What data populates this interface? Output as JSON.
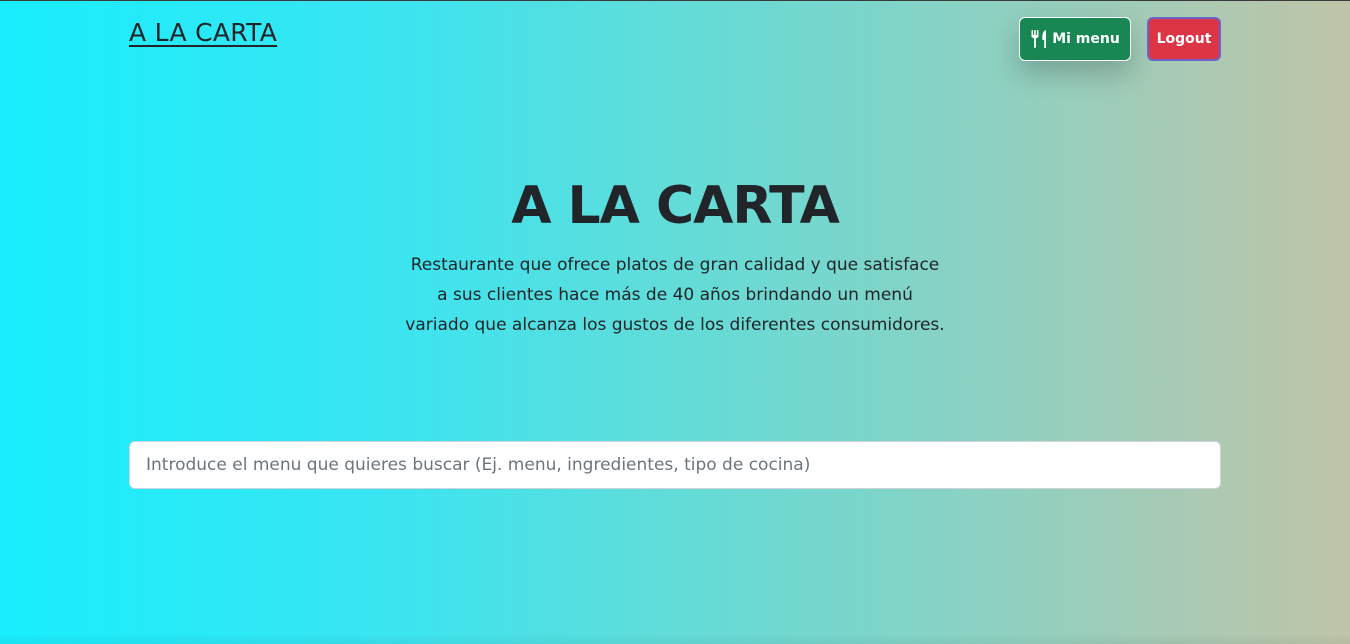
{
  "navbar": {
    "brand": "A LA CARTA",
    "menu_button": {
      "icon": "utensils-icon",
      "label": "Mi menu"
    },
    "logout_button": {
      "label": "Logout"
    }
  },
  "hero": {
    "title": "A LA CARTA",
    "description": "Restaurante que ofrece platos de gran calidad y que satisface a sus clientes hace más de 40 años brindando un menú variado que alcanza los gustos de los diferentes consumidores."
  },
  "search": {
    "placeholder": "Introduce el menu que quieres buscar (Ej. menu, ingredientes, tipo de cocina)",
    "value": ""
  },
  "colors": {
    "menu_button": "#198754",
    "logout_button": "#dc3545",
    "text": "#212529"
  }
}
